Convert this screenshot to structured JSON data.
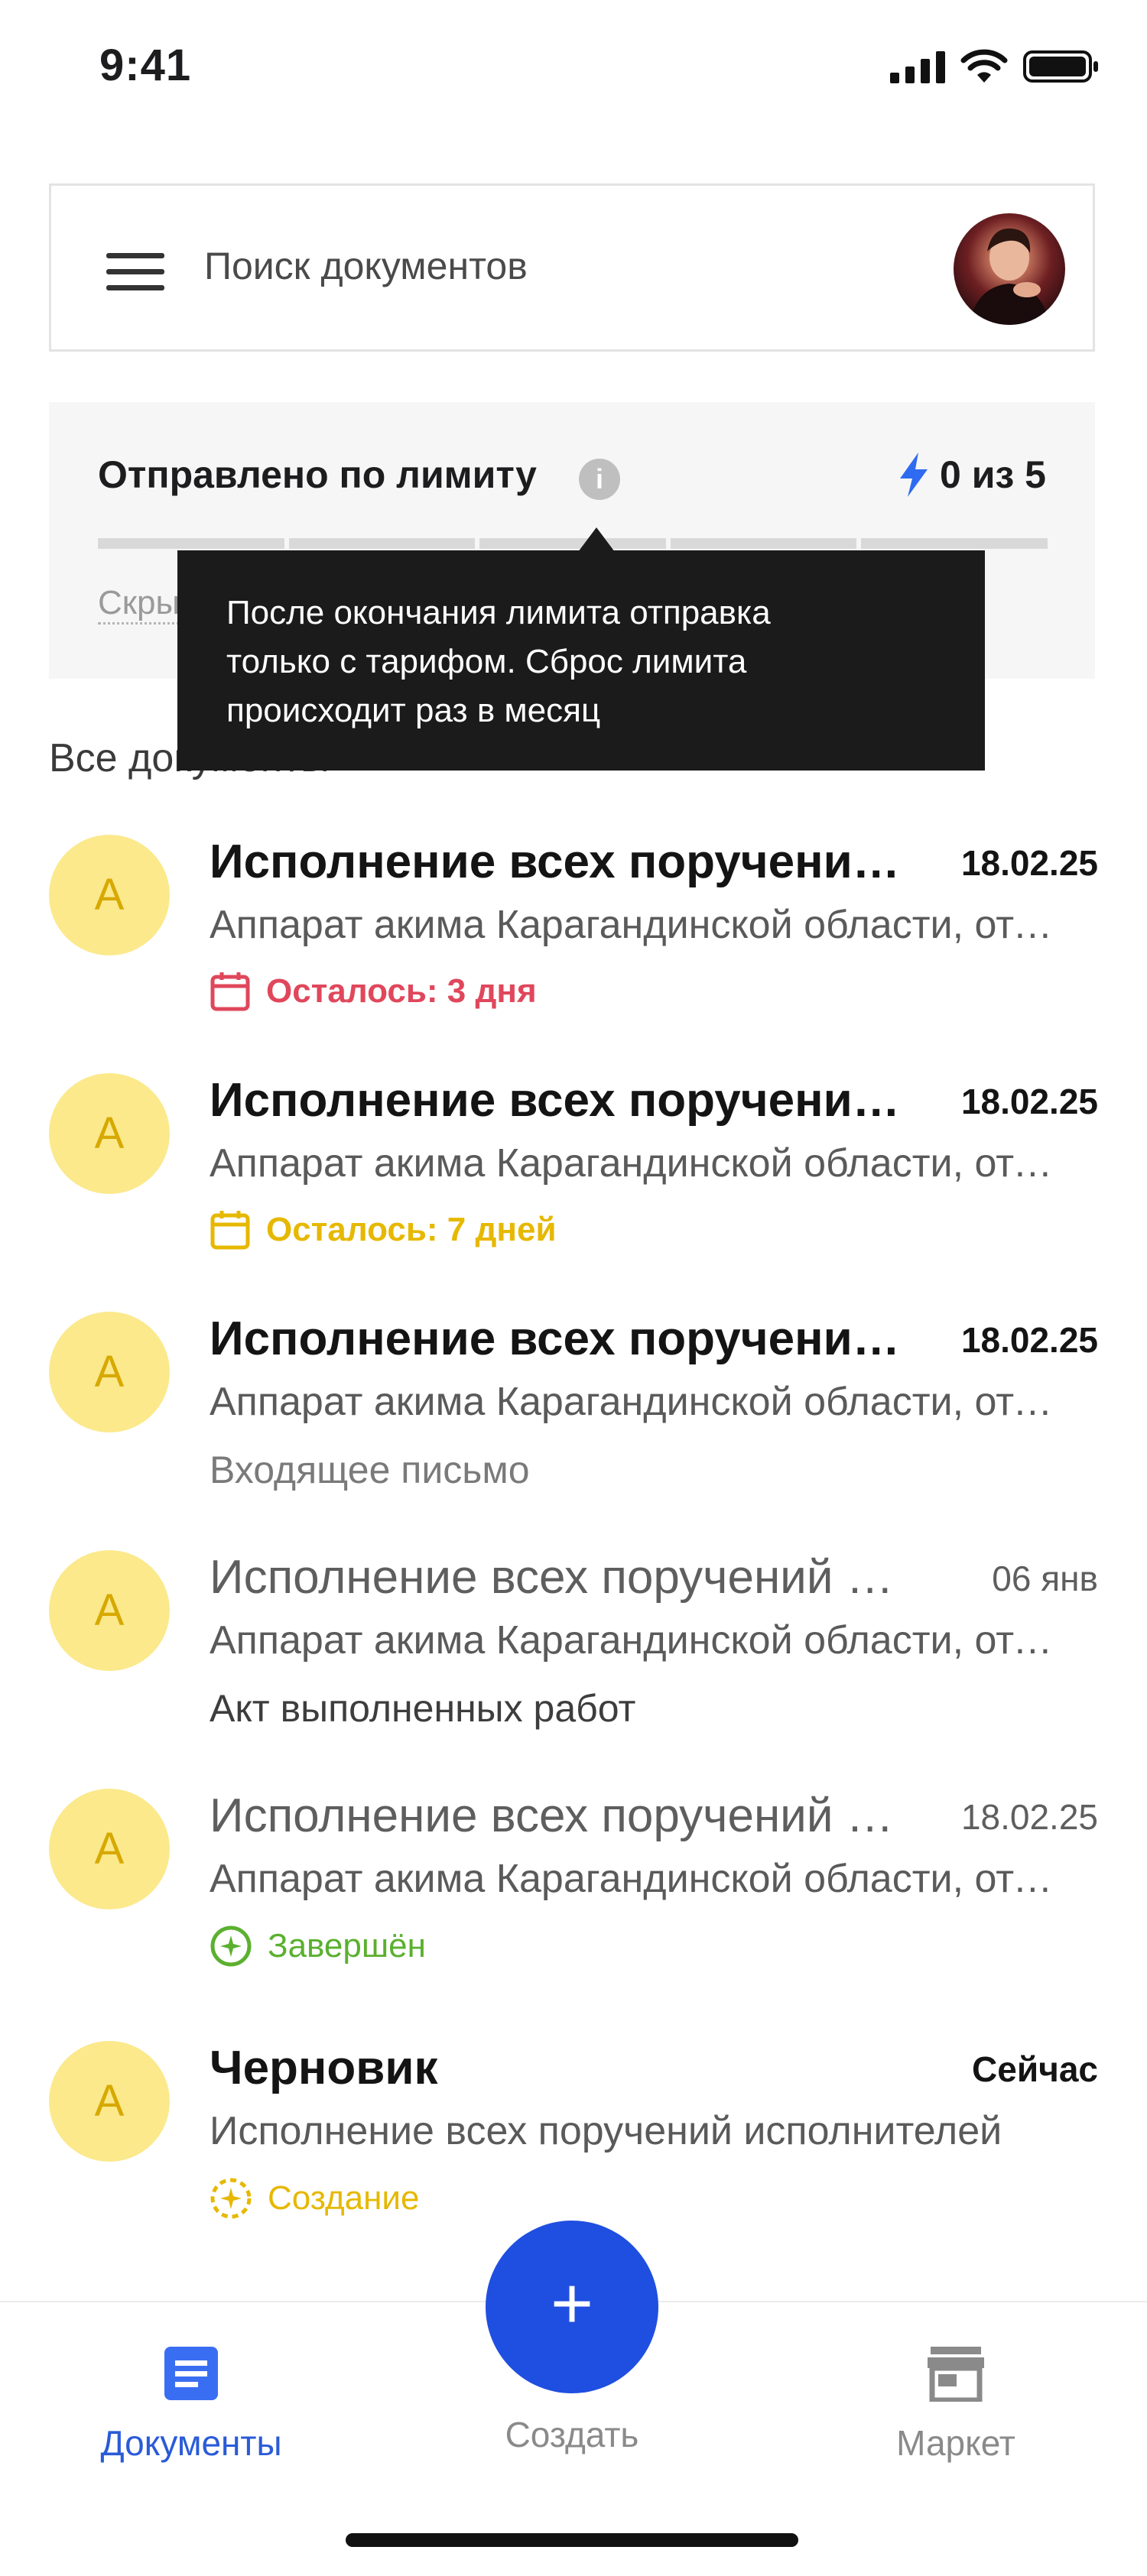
{
  "status_bar": {
    "time": "9:41"
  },
  "search": {
    "placeholder": "Поиск документов"
  },
  "limit": {
    "title": "Отправлено по лимиту",
    "count": "0 из 5",
    "hide_label": "Скрыть"
  },
  "tooltip": {
    "text": "После окончания лимита отправка\nтолько с тарифом. Сброс лимита\nпроисходит раз в месяц"
  },
  "section": {
    "title": "Все документы"
  },
  "documents": [
    {
      "avatar": "А",
      "title": "Исполнение всех поручений исполнителей",
      "date": "18.02.25",
      "subtitle": "Аппарат акима Карагандинской области, отдел",
      "status": "Осталось: 3 дня"
    },
    {
      "avatar": "А",
      "title": "Исполнение всех поручений исполнителей",
      "date": "18.02.25",
      "subtitle": "Аппарат акима Карагандинской области, отдел",
      "status": "Осталось: 7 дней"
    },
    {
      "avatar": "А",
      "title": "Исполнение всех поручений исполнителей",
      "date": "18.02.25",
      "subtitle": "Аппарат акима Карагандинской области, отдел",
      "status": "Входящее письмо"
    },
    {
      "avatar": "А",
      "title": "Исполнение всех поручений исполнителей",
      "date": "06 янв",
      "subtitle": "Аппарат акима Карагандинской области, отдел",
      "status": "Акт выполненных работ"
    },
    {
      "avatar": "А",
      "title": "Исполнение всех поручений исполнителей",
      "date": "18.02.25",
      "subtitle": "Аппарат акима Карагандинской области, отдел",
      "status": "Завершён"
    },
    {
      "avatar": "А",
      "title": "Черновик",
      "date": "Сейчас",
      "subtitle": "Исполнение всех поручений исполнителей",
      "status": "Создание"
    }
  ],
  "bottom_nav": {
    "documents": "Документы",
    "create": "Создать",
    "market": "Маркет",
    "fab_symbol": "+"
  },
  "colors": {
    "accent": "#1f4fe0",
    "overdue": "#e0475b",
    "warning": "#e6b800",
    "done": "#5bb02f",
    "avatar_bg": "#fbe98c"
  }
}
